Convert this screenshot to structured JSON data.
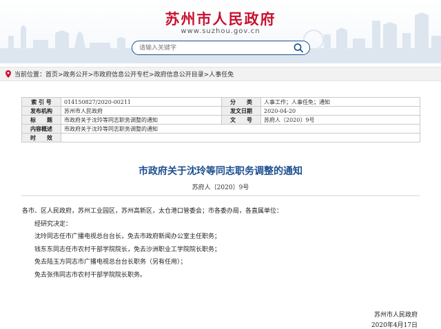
{
  "header": {
    "title": "苏州市人民政府",
    "domain": "www.suzhou.gov.cn",
    "search_placeholder": "请输入关键字",
    "brand_color": "#c8102e",
    "search_icon": "search-icon"
  },
  "breadcrumb": {
    "label": "当前位置：",
    "items": [
      "首页",
      "政务公开",
      "市政府信息公开专栏",
      "政府信息公开目录",
      "人事任免"
    ],
    "separator": ">"
  },
  "meta": {
    "labels": {
      "index_no": "索 引 号",
      "category": "分　　类",
      "issuer": "发布机构",
      "issue_date": "发文日期",
      "title": "标　　题",
      "doc_no": "文　　号",
      "summary": "内容概述",
      "validity": "时　　效"
    },
    "values": {
      "index_no": "014150827/2020-00211",
      "category": "人事工作；人事任免；通知",
      "issuer": "苏州市人民政府",
      "issue_date": "2020-04-20",
      "title": "市政府关于沈玲等同志职务调整的通知",
      "doc_no": "苏府人〔2020〕9号",
      "summary": "市政府关于沈玲等同志职务调整的通知",
      "validity": ""
    }
  },
  "article": {
    "title": "市政府关于沈玲等同志职务调整的通知",
    "doc_no": "苏府人〔2020〕9号",
    "paragraphs": [
      "各市、区人民政府，苏州工业园区，苏州高新区，太仓港口管委会；市各委办局，各直属单位：",
      "经研究决定：",
      "沈玲同志任市广播电视总台台长，免去市政府新闻办公室主任职务；",
      "钱东东同志任市农村干部学院院长，免去沙洲职业工学院院长职务；",
      "免去陆玉方同志市广播电视总台台长职务（另有任用）；",
      "免去张伟同志市农村干部学院院长职务。"
    ],
    "signature": "苏州市人民政府",
    "date": "2020年4月17日",
    "title_color": "#1d4e8f"
  }
}
